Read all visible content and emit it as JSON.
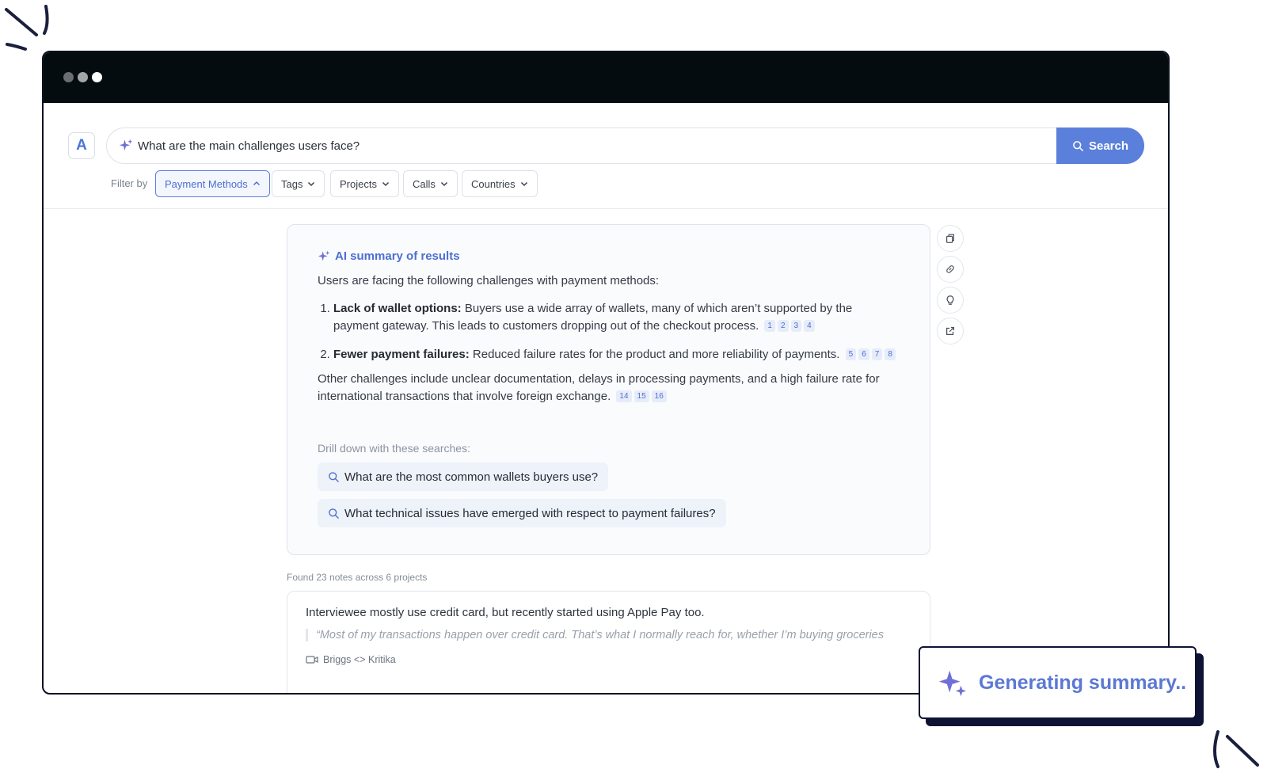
{
  "window": {
    "traffic_lights": [
      "close",
      "minimize",
      "maximize"
    ]
  },
  "search": {
    "avatar_letter": "A",
    "query": "What are the main challenges users face?",
    "button_label": "Search"
  },
  "filters": {
    "label": "Filter by",
    "chips": [
      {
        "label": "Payment Methods",
        "active": true
      },
      {
        "label": "Tags",
        "active": false
      },
      {
        "label": "Projects",
        "active": false
      },
      {
        "label": "Calls",
        "active": false
      },
      {
        "label": "Countries",
        "active": false
      }
    ]
  },
  "summary": {
    "title": "AI summary of results",
    "intro": "Users are facing the following challenges with payment methods:",
    "items": [
      {
        "number": "1.",
        "heading": "Lack of wallet options:",
        "text": "Buyers use a wide array of wallets, many of which aren’t supported by the payment gateway. This leads to customers dropping out of the checkout process.",
        "citations": [
          "1",
          "2",
          "3",
          "4"
        ]
      },
      {
        "number": "2.",
        "heading": "Fewer payment failures:",
        "text": "Reduced failure rates for the product and more reliability of payments.",
        "citations": [
          "5",
          "6",
          "7",
          "8"
        ]
      }
    ],
    "other": "Other challenges include unclear documentation, delays in processing payments, and a high failure rate for international transactions that involve foreign exchange.",
    "other_citations": [
      "14",
      "15",
      "16"
    ],
    "drill_label": "Drill down with these searches:",
    "suggestions": [
      "What are the most common wallets buyers use?",
      "What technical issues have emerged with respect to payment failures?"
    ]
  },
  "side_tools": [
    "copy-icon",
    "link-icon",
    "lightbulb-icon",
    "external-link-icon"
  ],
  "results": {
    "found_text": "Found 23 notes across 6 projects",
    "note": {
      "text": "Interviewee mostly use credit card, but recently started using Apple Pay too.",
      "quote": "“Most of my transactions happen over credit card. That’s what I normally reach for, whether I’m buying groceries",
      "call": "Briggs <> Kritika"
    }
  },
  "toast": {
    "label": "Generating summary.."
  },
  "colors": {
    "accent": "#5b80db",
    "titlebar": "#050c10",
    "toast_text": "#5b78d4",
    "sparkle": "#6f6fd8"
  }
}
